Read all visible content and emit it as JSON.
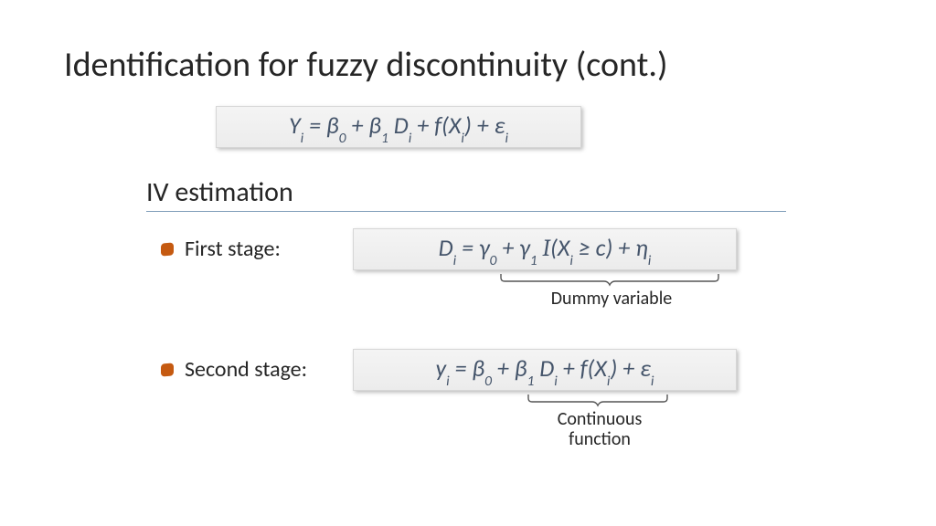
{
  "title": "Identification for fuzzy discontinuity (cont.)",
  "section": "IV estimation",
  "bullets": {
    "first": "First stage:",
    "second": "Second stage:"
  },
  "annotations": {
    "dummy": "Dummy variable",
    "continuous_l1": "Continuous",
    "continuous_l2": "function"
  },
  "equations": {
    "main": {
      "lhs": "Y",
      "lhs_sub": "i",
      "body": " = β",
      "b0s": "0",
      "plus1": " + β",
      "b1s": "1",
      "dvar": " D",
      "dsub": "i",
      "fx": " + f(X",
      "xsub": "i",
      "close": ") + ε",
      "esub": "i"
    },
    "first": {
      "lhs": "D",
      "lhs_sub": "i",
      "body": " = γ",
      "g0s": "0",
      "plus1": " + γ",
      "g1s": "1",
      "ind": " I",
      "paren": "(X",
      "xsub": "i",
      "geq": " ≥ c)",
      "plus2": " + η",
      "hsub": "i"
    },
    "second": {
      "lhs": "y",
      "lhs_sub": "i",
      "body": " = β",
      "b0s": "0",
      "plus1": " + β",
      "b1s": "1",
      "dvar": " D",
      "dsub": "i",
      "fx": " + f(X",
      "xsub": "i",
      "close": ") + ε",
      "esub": "i"
    }
  }
}
